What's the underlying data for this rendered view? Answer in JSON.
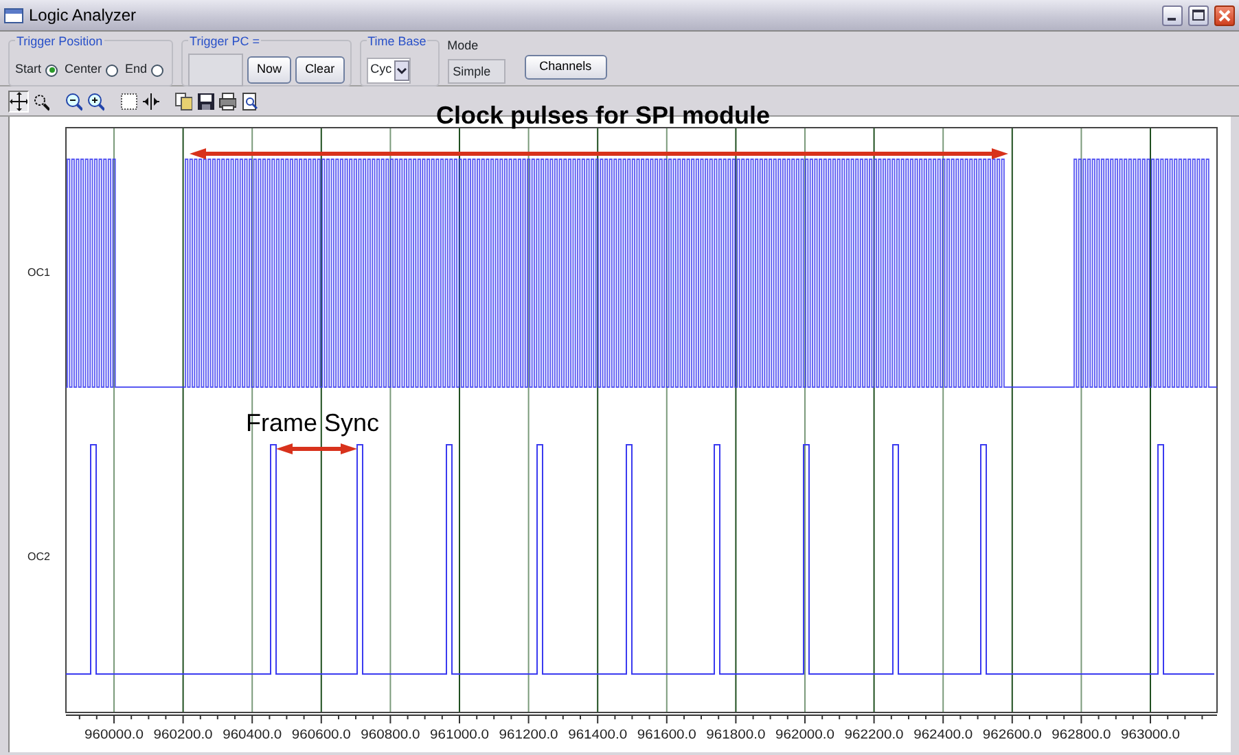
{
  "window": {
    "title": "Logic Analyzer"
  },
  "trigger_position": {
    "label": "Trigger Position",
    "options": [
      {
        "label": "Start",
        "selected": true
      },
      {
        "label": "Center",
        "selected": false
      },
      {
        "label": "End",
        "selected": false
      }
    ]
  },
  "trigger_pc": {
    "label": "Trigger PC =",
    "buttons": [
      "Now",
      "Clear"
    ]
  },
  "time_base": {
    "label": "Time Base",
    "value": "Cyc"
  },
  "mode": {
    "label": "Mode",
    "value": "Simple"
  },
  "channels_button": "Channels",
  "tools": [
    {
      "kind": "pan",
      "selected": true
    },
    {
      "kind": "zoom-region",
      "selected": false
    },
    {
      "kind": "zoom-out",
      "selected": false
    },
    {
      "kind": "zoom-in",
      "selected": false
    },
    {
      "kind": "select",
      "selected": false
    },
    {
      "kind": "cursor",
      "selected": false
    },
    {
      "kind": "copy",
      "selected": false
    },
    {
      "kind": "save",
      "selected": false
    },
    {
      "kind": "print",
      "selected": false
    },
    {
      "kind": "preview",
      "selected": false
    }
  ],
  "plot": {
    "channels": [
      {
        "name": "OC1"
      },
      {
        "name": "OC2"
      }
    ],
    "x_tick_labels": [
      "960000.0",
      "960200.0",
      "960400.0",
      "960600.0",
      "960800.0",
      "961000.0",
      "961200.0",
      "961400.0",
      "961600.0",
      "961800.0",
      "962000.0",
      "962200.0",
      "962400.0",
      "962600.0",
      "962800.0",
      "963000.0"
    ],
    "annotations": [
      {
        "text": "Clock pulses for SPI module",
        "kind": "bold"
      },
      {
        "text": "Frame Sync",
        "kind": "plain"
      }
    ]
  }
}
